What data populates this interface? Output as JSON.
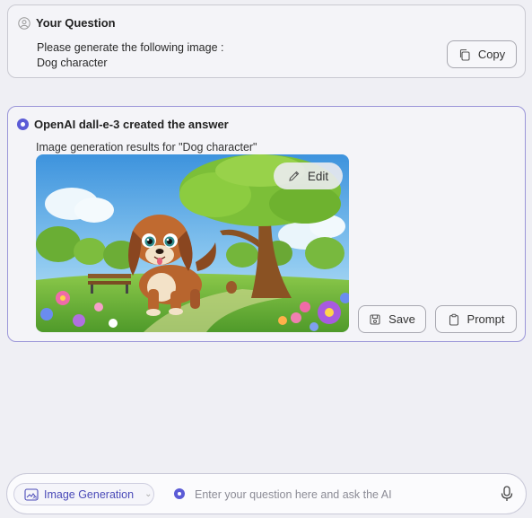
{
  "question": {
    "title": "Your Question",
    "line1": "Please generate the following image :",
    "line2": "Dog character",
    "copy_label": "Copy"
  },
  "answer": {
    "title": "OpenAI dall-e-3 created the answer",
    "subtitle": "Image generation results for \"Dog character\"",
    "edit_label": "Edit",
    "save_label": "Save",
    "prompt_label": "Prompt"
  },
  "input": {
    "mode_label": "Image Generation",
    "placeholder": "Enter your question here and ask the AI"
  },
  "icons": {
    "question": "person-icon",
    "answer": "radio-dot-icon",
    "copy": "copy-icon",
    "edit": "pencil-icon",
    "save": "save-icon",
    "prompt": "clipboard-icon",
    "mode": "image-ai-icon",
    "mic": "microphone-icon"
  },
  "colors": {
    "accent": "#5b5bd6",
    "answer_border": "#9a95d8",
    "background": "#efeff4"
  }
}
